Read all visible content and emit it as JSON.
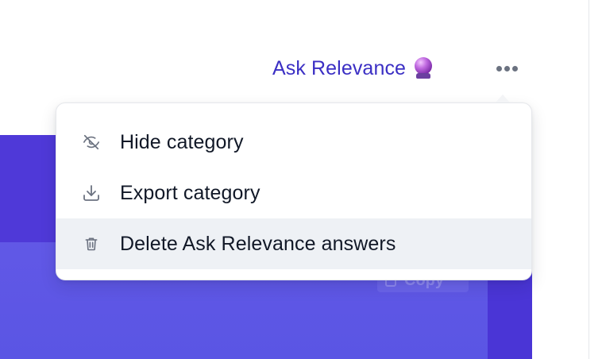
{
  "header": {
    "ask_label": "Ask Relevance",
    "ask_icon": "crystal-ball-icon",
    "more_icon": "more-horizontal-icon"
  },
  "menu": {
    "items": [
      {
        "label": "Hide category",
        "icon": "eye-off-icon"
      },
      {
        "label": "Export category",
        "icon": "download-icon"
      },
      {
        "label": "Delete Ask Relevance answers",
        "icon": "trash-icon",
        "highlighted": true
      }
    ]
  },
  "background_panel": {
    "copy_label": "Copy"
  },
  "colors": {
    "accent": "#3b2fc4",
    "panel_dark": "#4f39d8",
    "panel_light": "#6158e6",
    "menu_highlight": "#eef1f5",
    "text": "#111827",
    "icon": "#6b7280"
  }
}
